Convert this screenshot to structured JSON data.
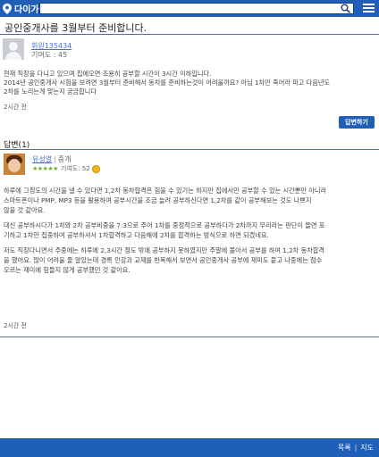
{
  "header": {
    "logo_text": "다이가",
    "search": {
      "value": "",
      "placeholder": ""
    },
    "icons": {
      "logo": "map-pin-icon",
      "search": "search-icon",
      "menu": "hamburger-menu-icon"
    },
    "colors": {
      "brand": "#1f5fb8"
    }
  },
  "question": {
    "title": "공인중개사를 3월부터 준비합니다.",
    "asker_name": "휘원135434",
    "asker_level": "기여도 : 45",
    "body_lines": [
      "현재 직장을 다니고 있으며 집에오면 조용히 공부할 시간이 3시간 이하입니다.",
      "2014년 공인중개사 시험을 보려면 3월부터 준비해서 동차를 준비하는것이 어려울까요? 아님 1차만 죽어라 파고 다음년도",
      "2차를 노리는게 맞는지 궁금합니다"
    ],
    "time": "2시간 전"
  },
  "answer_button_label": "답변하기",
  "answers_heading": "답변(1)",
  "answer": {
    "author_name": "유성열",
    "author_tag": "중개",
    "stars": "★★★★★",
    "contribution": "기여도: 52",
    "paragraphs": [
      [
        "하루에 그정도의 시간을 낼 수 있다면 1,2차 동차합격은 힘을 수 있기는 하지만 집에서만 공부할 수 있는 시간뿐만 아니라",
        "스마트폰이나 PMP, MP3 등을 활용하여 공부시간을 조금 늘려 공부하신다면 1,2차를 같이 공부해보는 것도 나쁘지",
        "않을 것 같아요."
      ],
      [
        "대신 공부하시다가 1차와 2차 공부비중을 7:3으로 주어 1차를 중점적으로 공부하다가 2차까지 무리라는 판단이 들면 포",
        "기하고 1차만 집중하여 공부하셔서 1차합격하고 다음해에 2차를 합격하는 방식으로 하면 되겠네요."
      ],
      [
        "저도 직장다니면서 주중에는 하루에 2,3시간 정도 밖에 공부하지 못하였지만 주말에 몰아서 공부를 하여 1,2차 동차합격",
        "을 했어요. 많이 어려울 줄 알았는데 경록 인강과 교재를 반복해서 보면서 공인중개사 공부에 재미도 붙고 나중에는 점수",
        "오르는 재미에 힘들지 않게 공부했던 것 같아요."
      ]
    ],
    "time": "2시간 전"
  },
  "footer": {
    "list_label": "목록",
    "map_label": "지도"
  }
}
